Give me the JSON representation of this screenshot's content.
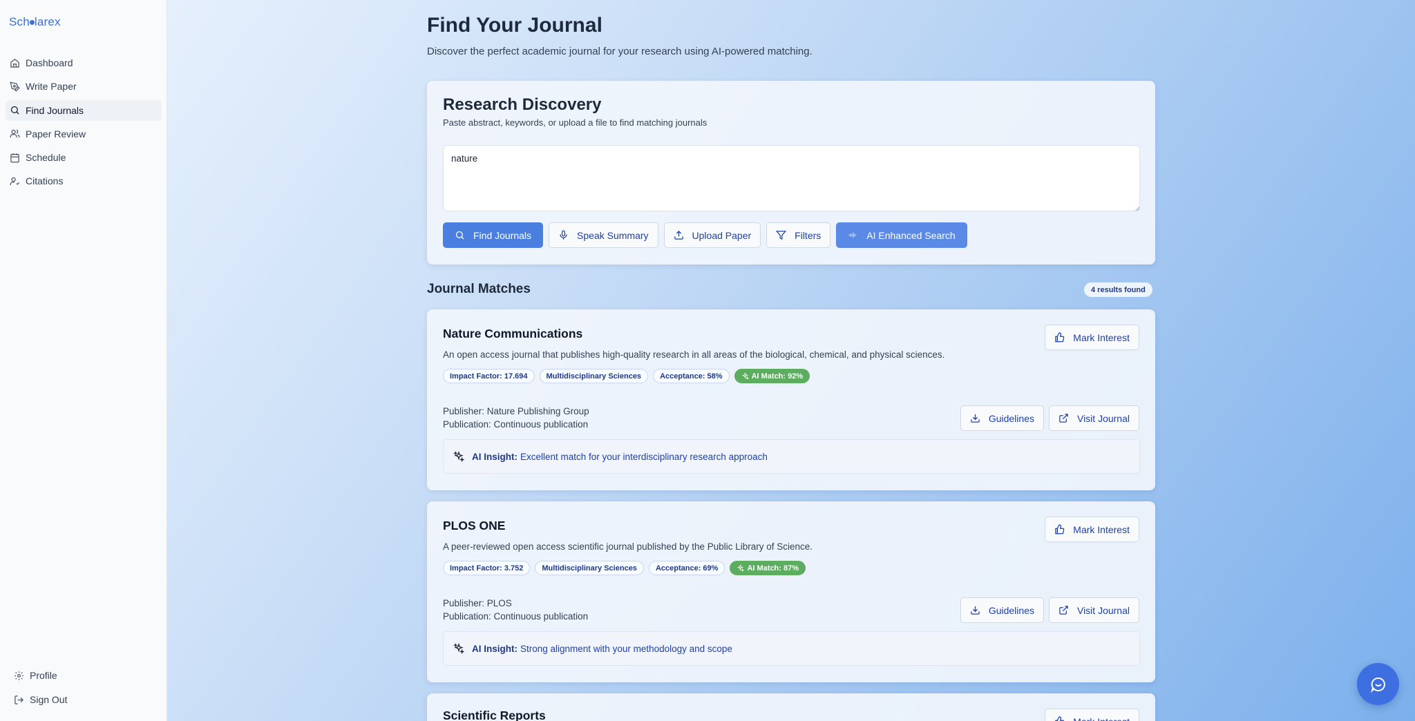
{
  "brand": {
    "name_part1": "Sch",
    "name_part2": "larex"
  },
  "sidebar": {
    "items": [
      {
        "label": "Dashboard",
        "icon": "home-icon"
      },
      {
        "label": "Write Paper",
        "icon": "pen-icon"
      },
      {
        "label": "Find Journals",
        "icon": "search-icon",
        "active": true
      },
      {
        "label": "Paper Review",
        "icon": "users-icon"
      },
      {
        "label": "Schedule",
        "icon": "calendar-icon"
      },
      {
        "label": "Citations",
        "icon": "user-check-icon"
      }
    ],
    "bottom": [
      {
        "label": "Profile",
        "icon": "gear-icon"
      },
      {
        "label": "Sign Out",
        "icon": "logout-icon"
      }
    ]
  },
  "header": {
    "title": "Find Your Journal",
    "subtitle": "Discover the perfect academic journal for your research using AI-powered matching."
  },
  "discovery": {
    "title": "Research Discovery",
    "hint": "Paste abstract, keywords, or upload a file to find matching journals",
    "query": "nature",
    "buttons": {
      "find": "Find Journals",
      "speak": "Speak Summary",
      "upload": "Upload Paper",
      "filters": "Filters",
      "ai": "AI Enhanced Search"
    }
  },
  "results": {
    "title": "Journal Matches",
    "count_label": "4 results found",
    "mark_label": "Mark Interest",
    "guidelines_label": "Guidelines",
    "visit_label": "Visit Journal",
    "insight_prefix": "AI Insight:",
    "journals": [
      {
        "name": "Nature Communications",
        "description": "An open access journal that publishes high-quality research in all areas of the biological, chemical, and physical sciences.",
        "impact": "Impact Factor: 17.694",
        "field": "Multidisciplinary Sciences",
        "acceptance": "Acceptance: 58%",
        "match": "AI Match: 92%",
        "publisher": "Publisher: Nature Publishing Group",
        "publication": "Publication: Continuous publication",
        "insight": "Excellent match for your interdisciplinary research approach"
      },
      {
        "name": "PLOS ONE",
        "description": "A peer-reviewed open access scientific journal published by the Public Library of Science.",
        "impact": "Impact Factor: 3.752",
        "field": "Multidisciplinary Sciences",
        "acceptance": "Acceptance: 69%",
        "match": "AI Match: 87%",
        "publisher": "Publisher: PLOS",
        "publication": "Publication: Continuous publication",
        "insight": "Strong alignment with your methodology and scope"
      },
      {
        "name": "Scientific Reports"
      }
    ]
  },
  "colors": {
    "accent": "#4a7fe0",
    "match_green": "#5cad5f",
    "brand": "#3b6fd8"
  }
}
